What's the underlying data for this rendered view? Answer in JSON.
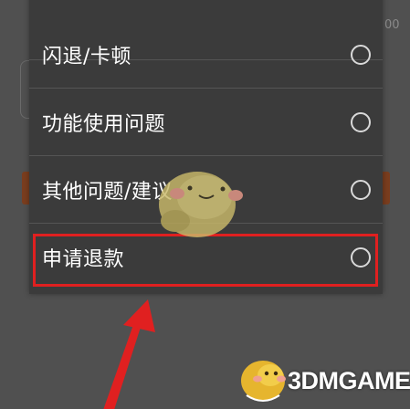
{
  "background": {
    "count_fragment": "00"
  },
  "menu": {
    "options": [
      {
        "label": "",
        "selected": false
      },
      {
        "label": "闪退/卡顿",
        "selected": false
      },
      {
        "label": "功能使用问题",
        "selected": false
      },
      {
        "label": "其他问题/建议",
        "selected": false
      },
      {
        "label": "申请退款",
        "selected": false,
        "highlighted": true
      }
    ]
  },
  "annotation": {
    "highlight_color": "#e02020",
    "arrow_color": "#e02020",
    "arrow_icon": "arrow-up-icon"
  },
  "watermark": {
    "mascot_icon": "duck-mascot-icon",
    "brand_text": "3DMGAME"
  }
}
